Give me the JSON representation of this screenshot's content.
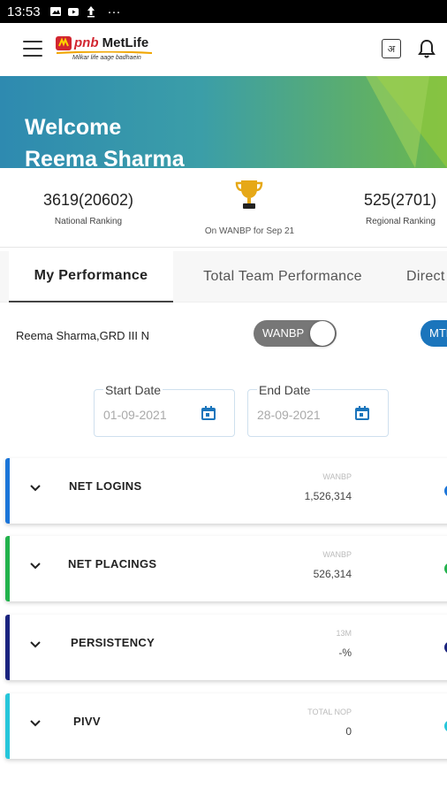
{
  "status_bar": {
    "time": "13:53",
    "icons": [
      "image-icon",
      "youtube-icon",
      "upload-icon"
    ],
    "more": "···"
  },
  "app_bar": {
    "logo_brand_prefix": "pnb",
    "logo_brand": "MetLife",
    "logo_tagline": "Milkar life aage badhaein",
    "lang_label": "अ",
    "icons": [
      "menu-icon",
      "language-icon",
      "bell-icon"
    ]
  },
  "hero": {
    "welcome": "Welcome",
    "user_name": "Reema Sharma"
  },
  "stats": {
    "national_value": "3619(20602)",
    "national_label": "National Ranking",
    "middle_label": "On WANBP for Sep 21",
    "regional_value": "525(2701)",
    "regional_label": "Regional Ranking"
  },
  "tabs": [
    {
      "label": "My Performance",
      "active": true
    },
    {
      "label": "Total Team Performance",
      "active": false
    },
    {
      "label": "Direct",
      "active": false
    }
  ],
  "agent": {
    "name": "Reema Sharma,GRD III N"
  },
  "toggle": {
    "label": "WANBP",
    "on": true
  },
  "mtd_label": "MTD",
  "dates": {
    "start_label": "Start Date",
    "start_value": "01-09-2021",
    "end_label": "End Date",
    "end_value": "28-09-2021"
  },
  "cards": [
    {
      "title": "NET LOGINS",
      "metric_label": "WANBP",
      "metric_value": "1,526,314",
      "color": "#1b75d8"
    },
    {
      "title": "NET PLACINGS",
      "metric_label": "WANBP",
      "metric_value": "526,314",
      "color": "#22b24c"
    },
    {
      "title": "PERSISTENCY",
      "metric_label": "13M",
      "metric_value": "-%",
      "color": "#1a237e"
    },
    {
      "title": "PIVV",
      "metric_label": "TOTAL NOP",
      "metric_value": "0",
      "color": "#26c6da"
    }
  ],
  "colors": {
    "accent_blue": "#1b75bc",
    "hero_start": "#2e8ab0",
    "hero_end": "#6bb84c"
  }
}
